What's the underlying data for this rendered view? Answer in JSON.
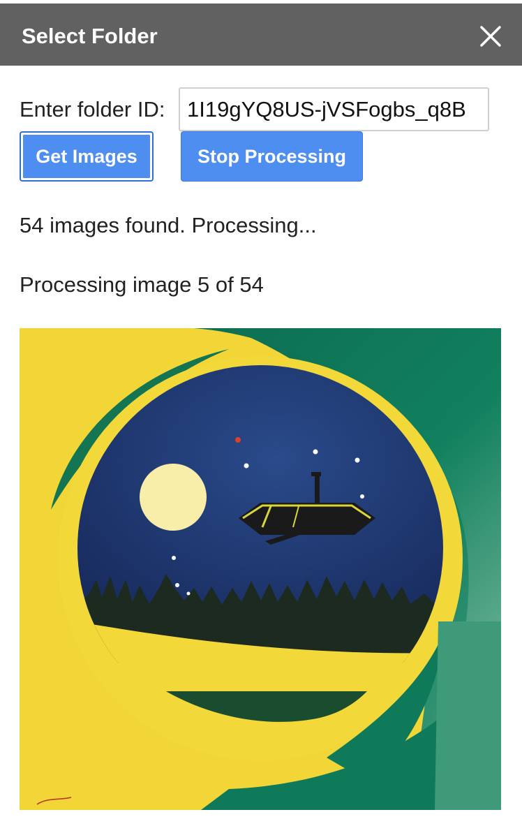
{
  "dialog": {
    "title": "Select Folder",
    "close_icon": "close-icon"
  },
  "form": {
    "label": "Enter folder ID:",
    "folder_id_value": "1I19gYQ8US-jVSFogbs_q8B",
    "get_images_label": "Get Images",
    "stop_processing_label": "Stop Processing"
  },
  "status": {
    "found": "54 images found. Processing...",
    "progress": "Processing image 5 of 54"
  },
  "colors": {
    "titlebar": "#616161",
    "button": "#4d8ef0",
    "image_yellow": "#f3d83a",
    "image_green": "#0f7a5a",
    "image_navy": "#1d3468"
  }
}
